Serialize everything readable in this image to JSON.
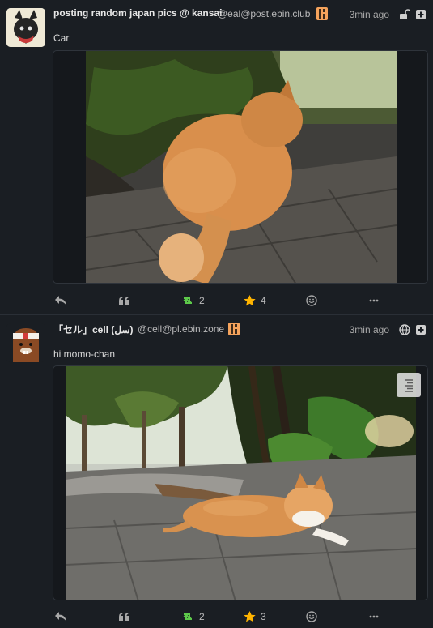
{
  "posts": [
    {
      "display_name": "posting random japan pics @ kansai",
      "handle": "@eal@post.ebin.club",
      "time": "3min ago",
      "scope_icon": "unlock-icon",
      "text": "Car",
      "actions": {
        "retweet_count": "2",
        "favorite_count": "4"
      }
    },
    {
      "display_name": "「セル」cell (سل)",
      "handle": "@cell@pl.ebin.zone",
      "time": "3min ago",
      "scope_icon": "globe-icon",
      "text": "hi momo-chan",
      "actions": {
        "retweet_count": "2",
        "favorite_count": "3"
      }
    }
  ],
  "colors": {
    "background": "#1a1e23",
    "retweet_green": "#5dc94a",
    "favorite_yellow": "#ffb400",
    "badge_orange": "#f5a35c"
  }
}
